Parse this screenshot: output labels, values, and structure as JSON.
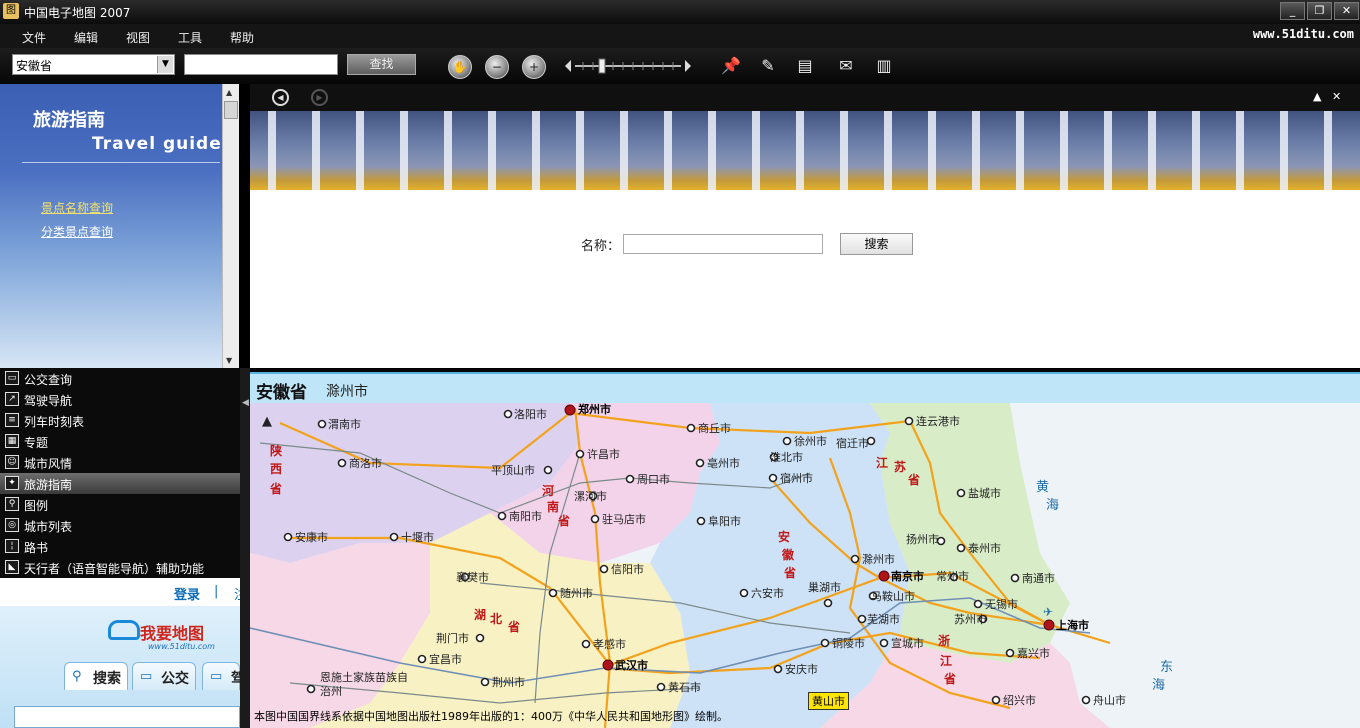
{
  "window": {
    "title": "中国电子地图 2007",
    "icon_glyph": "图",
    "controls": [
      "_",
      "❐",
      "✕"
    ]
  },
  "menu": {
    "items": [
      "文件",
      "编辑",
      "视图",
      "工具",
      "帮助"
    ],
    "brand_url": "www.51ditu.com"
  },
  "toolbar": {
    "province_value": "安徽省",
    "search_value": "",
    "find_label": "查找",
    "icons": [
      "hand-pan-icon",
      "zoom-out-icon",
      "zoom-in-icon",
      "zoom-slider",
      "pin-icon",
      "pencil-icon",
      "folder-icon",
      "send-mail-icon",
      "printer-icon"
    ]
  },
  "travel_guide": {
    "title_cn": "旅游指南",
    "title_en": "Travel guide",
    "links": [
      "景点名称查询",
      "分类景点查询"
    ],
    "colors": {
      "active_link": "#f5e36a",
      "link": "#ffffff"
    }
  },
  "nav": {
    "items": [
      {
        "label": "公交查询",
        "icon": "bus-icon"
      },
      {
        "label": "驾驶导航",
        "icon": "arrow-icon"
      },
      {
        "label": "列车时刻表",
        "icon": "train-icon"
      },
      {
        "label": "专题",
        "icon": "topic-icon"
      },
      {
        "label": "城市风情",
        "icon": "person-icon"
      },
      {
        "label": "旅游指南",
        "icon": "compass-icon",
        "active": true
      },
      {
        "label": "图例",
        "icon": "magnifier-icon"
      },
      {
        "label": "城市列表",
        "icon": "globe-icon"
      },
      {
        "label": "路书",
        "icon": "road-icon"
      },
      {
        "label": "天行者（语音智能导航）辅助功能",
        "icon": "navigator-icon"
      }
    ]
  },
  "ad": {
    "login": "登录",
    "sep": "|",
    "more": "注",
    "logo_text": "我要地图",
    "logo_url": "www.51ditu.com",
    "tabs": [
      "搜索",
      "公交",
      "驾"
    ]
  },
  "search_form": {
    "name_label": "名称：",
    "name_value": "",
    "button": "搜索"
  },
  "map": {
    "province": "安徽省",
    "city": "滁州市",
    "note": "本图中国国界线系依据中国地图出版社1989年出版的1：400万《中华人民共和国地形图》绘制。",
    "highlight_tag": "黄山市",
    "labels": {
      "zhengzhou": "郑州市",
      "luoyang": "洛阳市",
      "shangqiu": "商丘市",
      "lianyungang": "连云港市",
      "weinan": "渭南市",
      "xuzhou": "徐州市",
      "suqian": "宿迁市",
      "xuchang": "许昌市",
      "shangluo": "商洛市",
      "pingdingshan": "平顶山市",
      "bozhou": "亳州市",
      "huaibei": "淮北市",
      "zhoukou": "周口市",
      "suzhou_ah": "宿州市",
      "yancheng": "盐城市",
      "luohe": "漯河市",
      "nanyang": "南阳市",
      "zhumadian": "驻马店市",
      "fuyang": "阜阳市",
      "ankang": "安康市",
      "shiyan": "十堰市",
      "yangzhou": "扬州市",
      "taizhou": "泰州市",
      "chuzhou": "滁州市",
      "xiangfan": "襄樊市",
      "xinyang": "信阳市",
      "nanjing": "南京市",
      "changzhou": "常州市",
      "nantong": "南通市",
      "luan": "六安市",
      "chaohu": "巢湖市",
      "maanshan": "马鞍山市",
      "suizhou": "随州市",
      "wuxi": "无锡市",
      "wuhu": "芜湖市",
      "suzhou_js": "苏州市",
      "shanghai": "上海市",
      "jingmen": "荆门市",
      "xiaogan": "孝感市",
      "tongling": "铜陵市",
      "xuancheng": "宣城市",
      "yichang": "宜昌市",
      "wuhan": "武汉市",
      "jiaxing": "嘉兴市",
      "anqing": "安庆市",
      "enshi": "恩施土家族苗族自",
      "enshi2": "治州",
      "jingzhou": "荆州市",
      "huangshi": "黄石市",
      "shaoxing": "绍兴市",
      "zhoushan": "舟山市"
    },
    "province_chars": {
      "shaanxi": [
        "陕",
        "西",
        "省"
      ],
      "henan": [
        "河",
        "南",
        "省"
      ],
      "jiangsu": [
        "江",
        "苏",
        "省"
      ],
      "anhui": [
        "安",
        "徽",
        "省"
      ],
      "hubei": [
        "湖",
        "北",
        "省"
      ],
      "zhejiang": [
        "浙",
        "江",
        "省"
      ]
    },
    "seas": {
      "huanghai": [
        "黄",
        "海"
      ],
      "donghai": [
        "东",
        "海"
      ]
    },
    "colors": {
      "henan": "#f3d3ea",
      "shaanxi": "#dcd2f0",
      "jiangsu": "#d9ecc8",
      "anhui": "#cde2f6",
      "hubei": "#f8f1c4",
      "zhejiang": "#f7d8e6",
      "sea": "#eef3f8",
      "road": "#f3a21b"
    }
  }
}
